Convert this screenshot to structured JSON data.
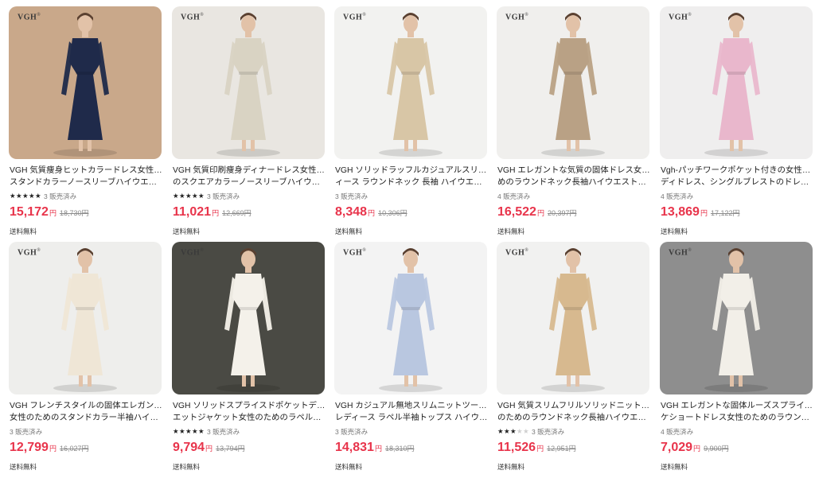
{
  "brand_logo": "VGH",
  "colors": {
    "price": "#e8344b",
    "text": "#222222",
    "muted": "#777777"
  },
  "products": [
    {
      "title1": "VGH 気質痩身ヒットカラードレス女性のための",
      "title2": "スタンドカラーノースリーブハイウエストスプライシ...",
      "stars": 5,
      "sold": "3 販売済み",
      "price": "15,172",
      "yen": "円",
      "original": "18,730円",
      "shipping": "送料無料",
      "bg": "#c9a88a",
      "garment": "#1f2a4a"
    },
    {
      "title1": "VGH 気質印刷痩身ディナードレス女性のため",
      "title2": "のスクエアカラーノースリーブハイウエストかわい...",
      "stars": 5,
      "sold": "3 販売済み",
      "price": "11,021",
      "yen": "円",
      "original": "12,669円",
      "shipping": "送料無料",
      "bg": "#e9e6e1",
      "garment": "#d9d3c3"
    },
    {
      "title1": "VGH ソリッドラッフルカジュアルスリムドレス レデ",
      "title2": "ィース ラウンドネック 長袖 ハイウエスト スプラ...",
      "stars": 0,
      "sold": "3 販売済み",
      "price": "8,348",
      "yen": "円",
      "original": "10,306円",
      "shipping": "送料無料",
      "bg": "#f2f2f0",
      "garment": "#d8c6a6"
    },
    {
      "title1": "VGH エレガントな気質の固体ドレス女性のた",
      "title2": "めのラウンドネック長袖ハイウエストスプライス...",
      "stars": 0,
      "sold": "4 販売済み",
      "price": "16,522",
      "yen": "円",
      "original": "20,397円",
      "shipping": "送料無料",
      "bg": "#f0efed",
      "garment": "#b9a185"
    },
    {
      "title1": "Vgh-パッチワークポケット付きの女性用ニットミ",
      "title2": "ディドレス、シングルブレストのドレス、スリムな...",
      "stars": 0,
      "sold": "4 販売済み",
      "price": "13,869",
      "yen": "円",
      "original": "17,122円",
      "shipping": "送料無料",
      "bg": "#efeeee",
      "garment": "#e9b7cc"
    },
    {
      "title1": "VGH フレンチスタイルの固体エレガントなドレス",
      "title2": "女性のためのスタンドカラー半袖ハイウエスト...",
      "stars": 0,
      "sold": "3 販売済み",
      "price": "12,799",
      "yen": "円",
      "original": "16,027円",
      "shipping": "送料無料",
      "bg": "#eeeeec",
      "garment": "#efe6d6"
    },
    {
      "title1": "VGH ソリッドスプライスドポケットデザイナーシル",
      "title2": "エットジャケット女性のためのラペル長袖秋の...",
      "stars": 5,
      "sold": "3 販売済み",
      "price": "9,794",
      "yen": "円",
      "original": "13,794円",
      "shipping": "送料無料",
      "bg": "#4a4a44",
      "garment": "#f4f1ea"
    },
    {
      "title1": "VGH カジュアル無地スリムニットツーピースセット",
      "title2": "レディース ラペル半袖トップス ハイウエストスカ...",
      "stars": 0,
      "sold": "3 販売済み",
      "price": "14,831",
      "yen": "円",
      "original": "18,310円",
      "shipping": "送料無料",
      "bg": "#f3f3f3",
      "garment": "#b9c7e0"
    },
    {
      "title1": "VGH 気質スリムフリルソリッドニットドレス女性",
      "title2": "のためのラウンドネック長袖ハイウエストスプラ...",
      "stars": 3,
      "sold": "3 販売済み",
      "price": "11,526",
      "yen": "円",
      "original": "12,951円",
      "shipping": "送料無料",
      "bg": "#f1f1f0",
      "garment": "#d7b98f"
    },
    {
      "title1": "VGH エレガントな固体ルーズスプライスアップリ",
      "title2": "ケショートドレス女性のためのラウンドネックノー...",
      "stars": 0,
      "sold": "4 販売済み",
      "price": "7,029",
      "yen": "円",
      "original": "9,900円",
      "shipping": "送料無料",
      "bg": "#8e8e8e",
      "garment": "#f2efe8"
    }
  ]
}
